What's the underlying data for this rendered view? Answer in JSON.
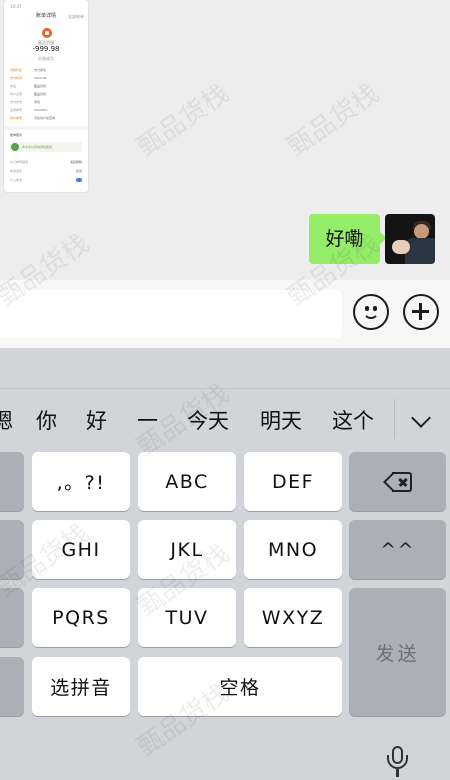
{
  "chat": {
    "screenshot_thumb": {
      "status_time": "10:47",
      "title": "账单详情",
      "action": "全部账单",
      "shop": "甄品货栈",
      "amount": "-999.98",
      "state": "交易成功",
      "rows": [
        {
          "k": "当前状态",
          "v": "支付成功",
          "orange": true
        },
        {
          "k": "支付时间",
          "v": "2022-06",
          "orange": true
        },
        {
          "k": "商品",
          "v": "甄品货栈",
          "orange": false
        },
        {
          "k": "商户全称",
          "v": "甄品货栈",
          "orange": false
        },
        {
          "k": "支付方式",
          "v": "零钱",
          "orange": true
        },
        {
          "k": "交易单号",
          "v": "4200001",
          "orange": false
        },
        {
          "k": "商户单号",
          "v": "可在商户处查询",
          "orange": true
        },
        {
          "k": "",
          "v": "",
          "orange": false
        }
      ],
      "section_label": "账单服务",
      "banner_text": "本次支付获得绿色能量",
      "bottom_rows": [
        {
          "k": "对订单有疑惑",
          "v": "发起群聊"
        },
        {
          "k": "申请退款",
          "v": "投诉"
        },
        {
          "k": "计入收支",
          "v": ""
        }
      ]
    },
    "sent_message": "好嘞"
  },
  "input_bar": {
    "emoji_icon": "smiley-face-icon",
    "plus_icon": "plus-circle-icon"
  },
  "keyboard": {
    "candidates": [
      "嗯",
      "你",
      "好",
      "一",
      "今天",
      "明天",
      "这个"
    ],
    "collapse_icon": "chevron-down-icon",
    "keys": {
      "punct": ",。?!",
      "abc": "ABC",
      "def": "DEF",
      "ghi": "GHI",
      "jkl": "JKL",
      "mno": "MNO",
      "pqrs": "PQRS",
      "tuv": "TUV",
      "wxyz": "WXYZ",
      "emoticon": "^^",
      "pinyin": "选拼音",
      "space": "空格",
      "send": "发送"
    },
    "backspace_icon": "backspace-icon",
    "mic_icon": "microphone-icon"
  },
  "watermark_text": "甄品货栈"
}
